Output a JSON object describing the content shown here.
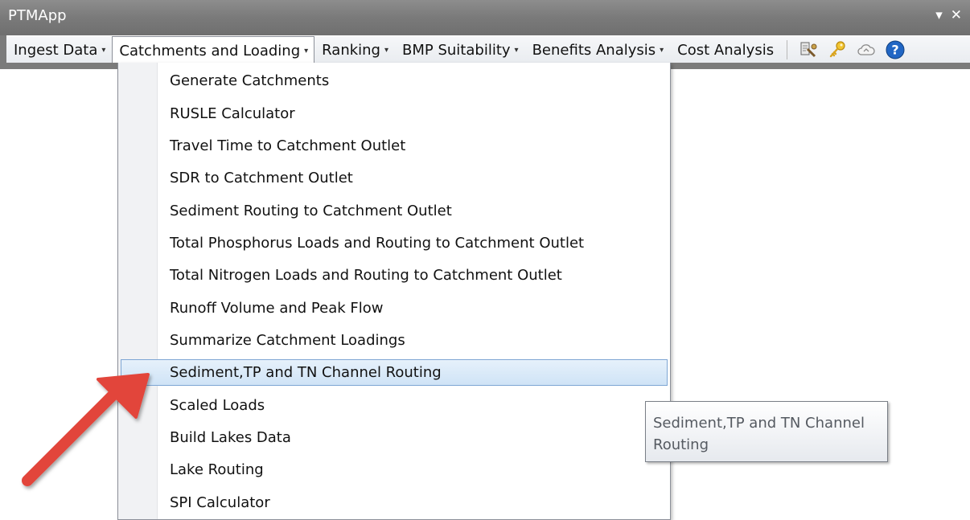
{
  "window": {
    "title": "PTMApp",
    "controls": {
      "dropdown_glyph": "▾",
      "close_glyph": "✕"
    }
  },
  "toolbar": {
    "menus": [
      {
        "label": "Ingest Data",
        "open": false
      },
      {
        "label": "Catchments and Loading",
        "open": true
      },
      {
        "label": "Ranking",
        "open": false
      },
      {
        "label": "BMP Suitability",
        "open": false
      },
      {
        "label": "Benefits Analysis",
        "open": false
      },
      {
        "label": "Cost Analysis",
        "open": false
      }
    ],
    "arrow_glyph": "▾",
    "icons": [
      "tools-icon",
      "key-icon",
      "cloud-icon",
      "help-icon"
    ]
  },
  "dropdown": {
    "items": [
      {
        "label": "Generate Catchments"
      },
      {
        "label": "RUSLE Calculator"
      },
      {
        "label": "Travel Time to Catchment Outlet"
      },
      {
        "label": "SDR to Catchment Outlet"
      },
      {
        "label": "Sediment Routing to Catchment Outlet"
      },
      {
        "label": "Total Phosphorus Loads and Routing to Catchment Outlet"
      },
      {
        "label": "Total Nitrogen Loads and Routing to Catchment Outlet"
      },
      {
        "label": "Runoff Volume and Peak Flow"
      },
      {
        "label": "Summarize Catchment Loadings"
      },
      {
        "label": "Sediment,TP and TN Channel Routing",
        "highlighted": true
      },
      {
        "label": "Scaled Loads"
      },
      {
        "label": "Build Lakes Data"
      },
      {
        "label": "Lake Routing"
      },
      {
        "label": "SPI Calculator"
      }
    ]
  },
  "tooltip": {
    "line1": "Sediment,TP and TN Channel",
    "line2": "Routing"
  },
  "colors": {
    "highlight_border": "#7ea6d4",
    "annotation_arrow": "#e2453b"
  }
}
